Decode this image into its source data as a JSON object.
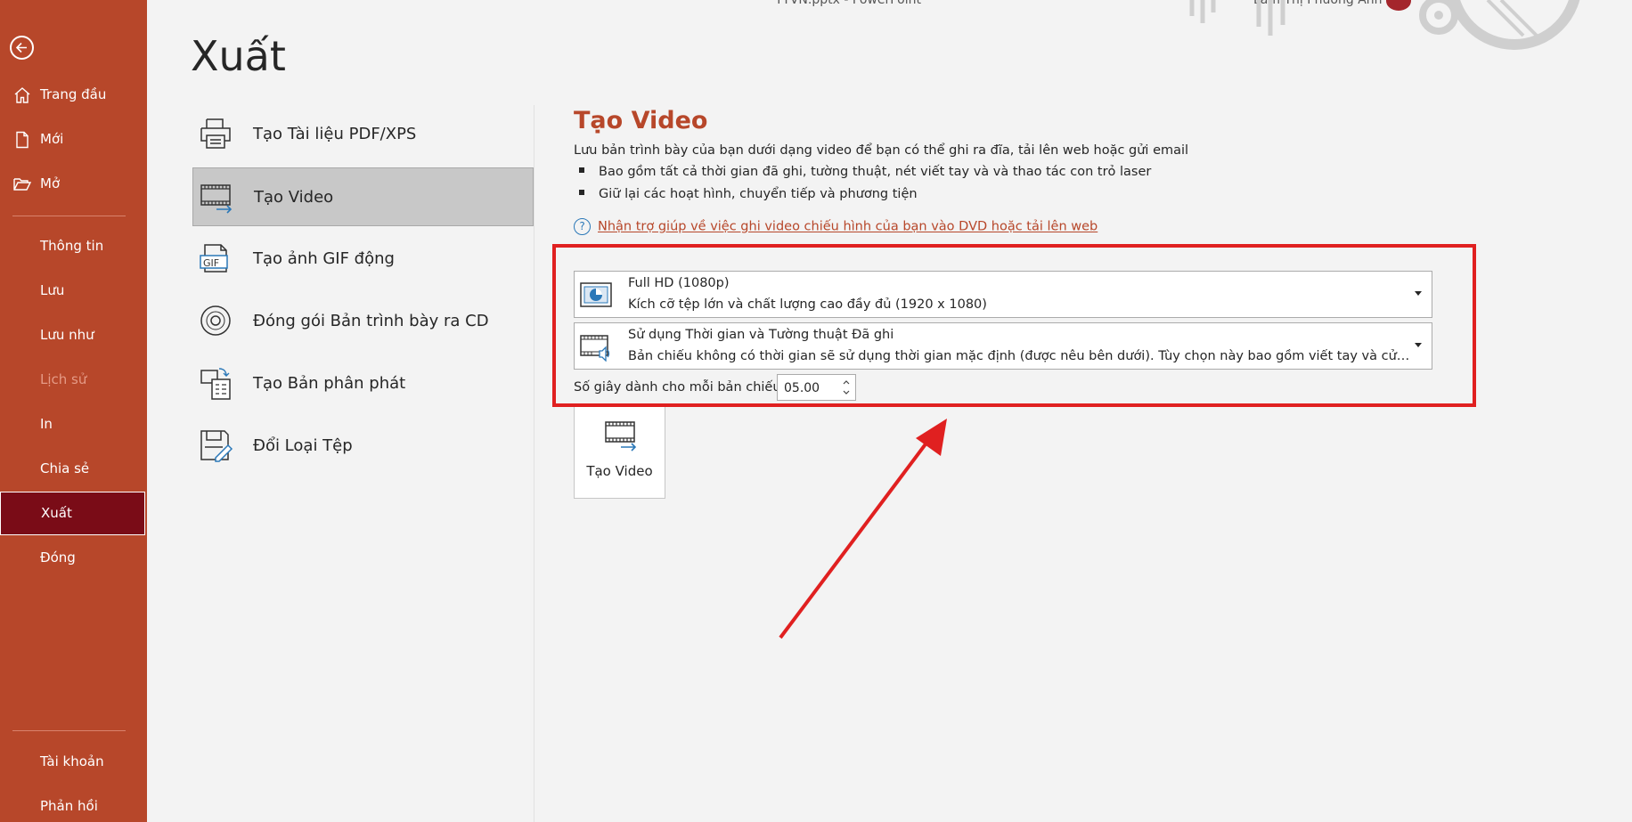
{
  "titlebar": {
    "filename": "TTVN.pptx",
    "separator": "-",
    "app": "PowerPoint",
    "user": "Lâm Thị Phương Anh"
  },
  "sidebar": {
    "items": [
      {
        "label": "Trang đầu",
        "icon": "home-icon"
      },
      {
        "label": "Mới",
        "icon": "new-document-icon"
      },
      {
        "label": "Mở",
        "icon": "folder-open-icon"
      },
      {
        "label": "Thông tin"
      },
      {
        "label": "Lưu"
      },
      {
        "label": "Lưu như"
      },
      {
        "label": "Lịch sử",
        "disabled": true
      },
      {
        "label": "In"
      },
      {
        "label": "Chia sẻ"
      },
      {
        "label": "Xuất",
        "active": true
      },
      {
        "label": "Đóng"
      },
      {
        "label": "Tài khoản"
      },
      {
        "label": "Phản hồi"
      }
    ]
  },
  "page": {
    "title": "Xuất"
  },
  "export_options": [
    {
      "label": "Tạo Tài liệu PDF/XPS",
      "icon": "pdf-document-icon"
    },
    {
      "label": "Tạo Video",
      "icon": "video-icon",
      "selected": true
    },
    {
      "label": "Tạo ảnh GIF động",
      "icon": "gif-icon"
    },
    {
      "label": "Đóng gói Bản trình bày ra CD",
      "icon": "cd-icon"
    },
    {
      "label": "Tạo Bản phân phát",
      "icon": "handout-icon"
    },
    {
      "label": "Đổi Loại Tệp",
      "icon": "change-file-type-icon"
    }
  ],
  "video_panel": {
    "title": "Tạo Video",
    "description": "Lưu bản trình bày của bạn dưới dạng video để bạn có thể ghi ra đĩa, tải lên web hoặc gửi email",
    "bullets": [
      "Bao gồm tất cả thời gian đã ghi, tường thuật, nét viết tay và và thao tác con trỏ laser",
      "Giữ lại các hoạt hình, chuyển tiếp và phương tiện"
    ],
    "help_link": "Nhận trợ giúp về việc ghi video chiếu hình của bạn vào DVD hoặc tải lên web",
    "quality": {
      "title": "Full HD (1080p)",
      "subtitle": "Kích cỡ tệp lớn và chất lượng cao đầy đủ (1920 x 1080)"
    },
    "timing": {
      "title": "Sử dụng Thời gian và Tường thuật Đã ghi",
      "subtitle": "Bản chiếu không có thời gian sẽ sử dụng thời gian mặc định (được nêu bên dưới). Tùy chọn này bao gồm viết tay và cử chỉ con trỏ laser."
    },
    "seconds_label": "Số giây dành cho mỗi bản chiếu:",
    "seconds_value": "05.00",
    "create_button": "Tạo Video"
  },
  "colors": {
    "sidebar": "#b7472a",
    "sidebar_active": "#7a0c17",
    "accent": "#b7472a",
    "annotation": "#e02020"
  }
}
